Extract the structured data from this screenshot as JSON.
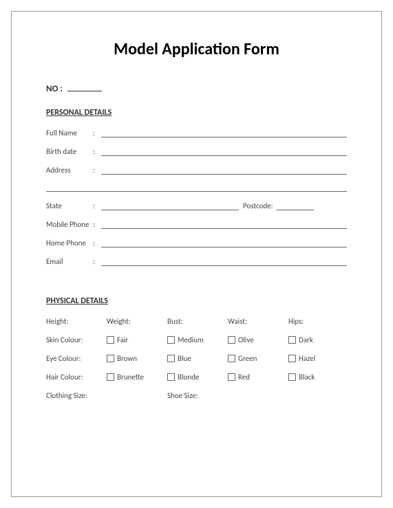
{
  "title": "Model Application Form",
  "no_label": "NO :",
  "sections": {
    "personal": {
      "heading": "PERSONAL DETAILS",
      "fields": {
        "full_name": "Full Name",
        "birth_date": "Birth date",
        "address": "Address",
        "state": "State",
        "postcode": "Postcode:",
        "mobile_phone": "Mobile Phone",
        "home_phone": "Home Phone",
        "email": "Email"
      }
    },
    "physical": {
      "heading": "PHYSICAL DETAILS",
      "measurements": {
        "height": "Height:",
        "weight": "Weight:",
        "bust": "Bust:",
        "waist": "Waist:",
        "hips": "Hips:"
      },
      "skin": {
        "label": "Skin Colour:",
        "options": [
          "Fair",
          "Medium",
          "Olive",
          "Dark"
        ]
      },
      "eye": {
        "label": "Eye Colour:",
        "options": [
          "Brown",
          "Blue",
          "Green",
          "Hazel"
        ]
      },
      "hair": {
        "label": "Hair Colour:",
        "options": [
          "Brunette",
          "Blonde",
          "Red",
          "Black"
        ]
      },
      "clothing_size": "Clothing Size:",
      "shoe_size": "Shoe Size:"
    }
  },
  "colon": ":"
}
